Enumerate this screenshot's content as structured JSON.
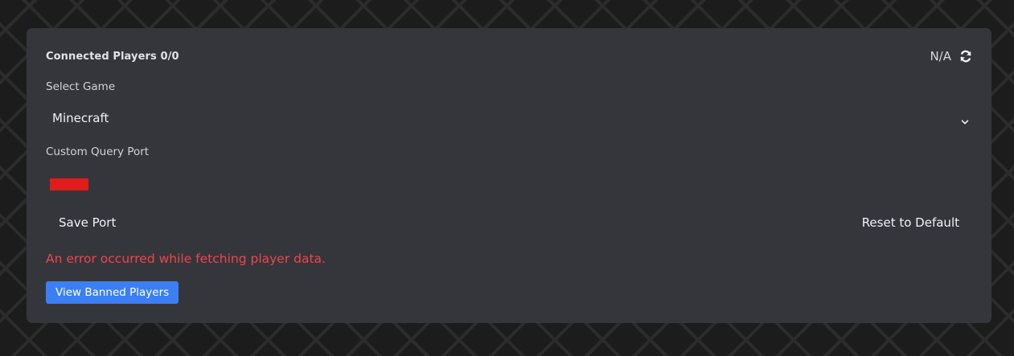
{
  "header": {
    "title": "Connected Players 0/0",
    "status": "N/A",
    "refresh_icon": "refresh-icon"
  },
  "game_select": {
    "label": "Select Game",
    "value": "Minecraft",
    "chevron_icon": "chevron-down-icon"
  },
  "query_port": {
    "label": "Custom Query Port",
    "value": ""
  },
  "actions": {
    "save_label": "Save Port",
    "reset_label": "Reset to Default"
  },
  "error": {
    "message": "An error occurred while fetching player data.",
    "color": "#e8484e"
  },
  "banned": {
    "button_label": "View Banned Players",
    "color": "#3b7ff5"
  }
}
